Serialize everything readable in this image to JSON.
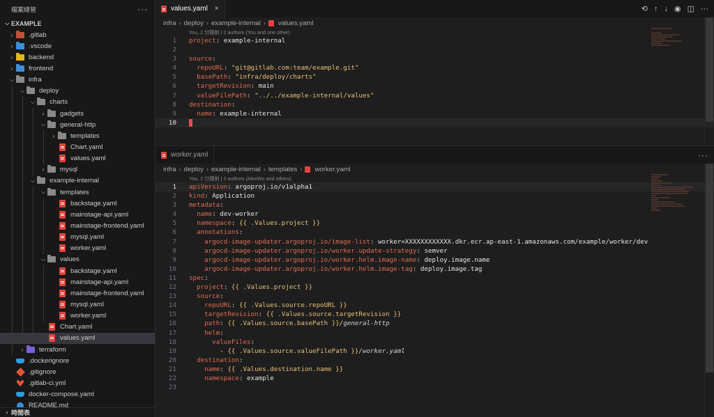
{
  "explorer": {
    "title": "檔案總管",
    "more_icon": "ellipsis-icon",
    "root": "EXAMPLE",
    "footer": "時間表",
    "items": [
      {
        "depth": 0,
        "label": ".gitlab",
        "kind": "folder",
        "open": false,
        "color": "#c0513a"
      },
      {
        "depth": 0,
        "label": ".vscode",
        "kind": "folder",
        "open": false,
        "color": "#3d8fd8"
      },
      {
        "depth": 0,
        "label": "backend",
        "kind": "folder",
        "open": false,
        "color": "#e6b422"
      },
      {
        "depth": 0,
        "label": "frontend",
        "kind": "folder",
        "open": false,
        "color": "#3d8fd8"
      },
      {
        "depth": 0,
        "label": "infra",
        "kind": "folder",
        "open": true,
        "color": "#8a8a8a"
      },
      {
        "depth": 1,
        "label": "deploy",
        "kind": "folder",
        "open": true,
        "color": "#8a8a8a"
      },
      {
        "depth": 2,
        "label": "charts",
        "kind": "folder",
        "open": true,
        "color": "#8a8a8a"
      },
      {
        "depth": 3,
        "label": "gadgets",
        "kind": "folder",
        "open": false,
        "color": "#8a8a8a"
      },
      {
        "depth": 3,
        "label": "general-http",
        "kind": "folder",
        "open": true,
        "color": "#8a8a8a"
      },
      {
        "depth": 4,
        "label": "templates",
        "kind": "folder",
        "open": false,
        "color": "#8a8a8a"
      },
      {
        "depth": 4,
        "label": "Chart.yaml",
        "kind": "file"
      },
      {
        "depth": 4,
        "label": "values.yaml",
        "kind": "file"
      },
      {
        "depth": 3,
        "label": "mysql",
        "kind": "folder",
        "open": false,
        "color": "#8a8a8a"
      },
      {
        "depth": 2,
        "label": "example-internal",
        "kind": "folder",
        "open": true,
        "color": "#8a8a8a"
      },
      {
        "depth": 3,
        "label": "templates",
        "kind": "folder",
        "open": true,
        "color": "#8a8a8a"
      },
      {
        "depth": 4,
        "label": "backstage.yaml",
        "kind": "file"
      },
      {
        "depth": 4,
        "label": "mainstage-api.yaml",
        "kind": "file"
      },
      {
        "depth": 4,
        "label": "mainstage-frontend.yaml",
        "kind": "file"
      },
      {
        "depth": 4,
        "label": "mysql.yaml",
        "kind": "file"
      },
      {
        "depth": 4,
        "label": "worker.yaml",
        "kind": "file"
      },
      {
        "depth": 3,
        "label": "values",
        "kind": "folder",
        "open": true,
        "color": "#8a8a8a"
      },
      {
        "depth": 4,
        "label": "backstage.yaml",
        "kind": "file"
      },
      {
        "depth": 4,
        "label": "mainstage-api.yaml",
        "kind": "file"
      },
      {
        "depth": 4,
        "label": "mainstage-frontend.yaml",
        "kind": "file"
      },
      {
        "depth": 4,
        "label": "mysql.yaml",
        "kind": "file"
      },
      {
        "depth": 4,
        "label": "worker.yaml",
        "kind": "file"
      },
      {
        "depth": 3,
        "label": "Chart.yaml",
        "kind": "file"
      },
      {
        "depth": 3,
        "label": "values.yaml",
        "kind": "file",
        "selected": true
      },
      {
        "depth": 1,
        "label": "terraform",
        "kind": "folder",
        "open": false,
        "color": "#7b61d8"
      },
      {
        "depth": 0,
        "label": ".dockerignore",
        "kind": "docker"
      },
      {
        "depth": 0,
        "label": ".gitignore",
        "kind": "git"
      },
      {
        "depth": 0,
        "label": ".gitlab-ci.yml",
        "kind": "fox"
      },
      {
        "depth": 0,
        "label": "docker-compose.yaml",
        "kind": "docker"
      },
      {
        "depth": 0,
        "label": "README.md",
        "kind": "info"
      }
    ]
  },
  "editor1": {
    "tab": "values.yaml",
    "close": "×",
    "breadcrumb": [
      "infra",
      "deploy",
      "example-internal",
      "values.yaml"
    ],
    "blame": "You, 2 分鐘前 | 2 authors (You and one other)",
    "active_line": 10,
    "lines": [
      [
        [
          "k",
          "project"
        ],
        [
          "p",
          ": "
        ],
        [
          "v",
          "example-internal"
        ]
      ],
      [],
      [
        [
          "k",
          "source"
        ],
        [
          "p",
          ":"
        ]
      ],
      [
        [
          "p",
          "  "
        ],
        [
          "k",
          "repoURL"
        ],
        [
          "p",
          ": "
        ],
        [
          "s",
          "\"git@gitlab.com:team/example.git\""
        ]
      ],
      [
        [
          "p",
          "  "
        ],
        [
          "k",
          "basePath"
        ],
        [
          "p",
          ": "
        ],
        [
          "s",
          "\"infra/deploy/charts\""
        ]
      ],
      [
        [
          "p",
          "  "
        ],
        [
          "k",
          "targetRevision"
        ],
        [
          "p",
          ": "
        ],
        [
          "v",
          "main"
        ]
      ],
      [
        [
          "p",
          "  "
        ],
        [
          "k",
          "valueFilePath"
        ],
        [
          "p",
          ": "
        ],
        [
          "s",
          "\"../../example-internal/values\""
        ]
      ],
      [
        [
          "k",
          "destination"
        ],
        [
          "p",
          ":"
        ]
      ],
      [
        [
          "p",
          "  "
        ],
        [
          "k",
          "name"
        ],
        [
          "p",
          ": "
        ],
        [
          "v",
          "example-internal"
        ]
      ],
      [
        [
          "cursor",
          ""
        ]
      ]
    ]
  },
  "editor2": {
    "tab": "worker.yaml",
    "breadcrumb": [
      "infra",
      "deploy",
      "example-internal",
      "templates",
      "worker.yaml"
    ],
    "blame": "You, 2 分鐘前 | 3 authors (AlexWu and others)",
    "active_line": 1,
    "lines": [
      [
        [
          "k",
          "apiVersion"
        ],
        [
          "p",
          ": "
        ],
        [
          "v",
          "argoproj.io/v1alpha1"
        ]
      ],
      [
        [
          "k",
          "kind"
        ],
        [
          "p",
          ": "
        ],
        [
          "v",
          "Application"
        ]
      ],
      [
        [
          "k",
          "metadata"
        ],
        [
          "p",
          ":"
        ]
      ],
      [
        [
          "p",
          "  "
        ],
        [
          "k",
          "name"
        ],
        [
          "p",
          ": "
        ],
        [
          "v",
          "dev-worker"
        ]
      ],
      [
        [
          "p",
          "  "
        ],
        [
          "k",
          "namespace"
        ],
        [
          "p",
          ": "
        ],
        [
          "b",
          "{{ .Values.project }}"
        ]
      ],
      [
        [
          "p",
          "  "
        ],
        [
          "k",
          "annotations"
        ],
        [
          "p",
          ":"
        ]
      ],
      [
        [
          "p",
          "    "
        ],
        [
          "k",
          "argocd-image-updater.argoproj.io/image-list"
        ],
        [
          "p",
          ": "
        ],
        [
          "v",
          "worker=XXXXXXXXXXXX.dkr.ecr.ap-east-1.amazonaws.com/example/worker/dev"
        ]
      ],
      [
        [
          "p",
          "    "
        ],
        [
          "k",
          "argocd-image-updater.argoproj.io/worker.update-strategy"
        ],
        [
          "p",
          ": "
        ],
        [
          "v",
          "semver"
        ]
      ],
      [
        [
          "p",
          "    "
        ],
        [
          "k",
          "argocd-image-updater.argoproj.io/worker.helm.image-name"
        ],
        [
          "p",
          ": "
        ],
        [
          "v",
          "deploy.image.name"
        ]
      ],
      [
        [
          "p",
          "    "
        ],
        [
          "k",
          "argocd-image-updater.argoproj.io/worker.helm.image-tag"
        ],
        [
          "p",
          ": "
        ],
        [
          "v",
          "deploy.image.tag"
        ]
      ],
      [
        [
          "k",
          "spec"
        ],
        [
          "p",
          ":"
        ]
      ],
      [
        [
          "p",
          "  "
        ],
        [
          "k",
          "project"
        ],
        [
          "p",
          ": "
        ],
        [
          "b",
          "{{ .Values.project }}"
        ]
      ],
      [
        [
          "p",
          "  "
        ],
        [
          "k",
          "source"
        ],
        [
          "p",
          ":"
        ]
      ],
      [
        [
          "p",
          "    "
        ],
        [
          "k",
          "repoURL"
        ],
        [
          "p",
          ": "
        ],
        [
          "b",
          "{{ .Values.source.repoURL }}"
        ]
      ],
      [
        [
          "p",
          "    "
        ],
        [
          "k",
          "targetRevision"
        ],
        [
          "p",
          ": "
        ],
        [
          "b",
          "{{ .Values.source.targetRevision }}"
        ]
      ],
      [
        [
          "p",
          "    "
        ],
        [
          "k",
          "path"
        ],
        [
          "p",
          ": "
        ],
        [
          "b",
          "{{ .Values.source.basePath }}"
        ],
        [
          "it",
          "/general-http"
        ]
      ],
      [
        [
          "p",
          "    "
        ],
        [
          "k",
          "helm"
        ],
        [
          "p",
          ":"
        ]
      ],
      [
        [
          "p",
          "      "
        ],
        [
          "k",
          "valueFiles"
        ],
        [
          "p",
          ":"
        ]
      ],
      [
        [
          "p",
          "        - "
        ],
        [
          "b",
          "{{ .Values.source.valueFilePath }}"
        ],
        [
          "it",
          "/worker.yaml"
        ]
      ],
      [
        [
          "p",
          "  "
        ],
        [
          "k",
          "destination"
        ],
        [
          "p",
          ":"
        ]
      ],
      [
        [
          "p",
          "    "
        ],
        [
          "k",
          "name"
        ],
        [
          "p",
          ": "
        ],
        [
          "b",
          "{{ .Values.destination.name }}"
        ]
      ],
      [
        [
          "p",
          "    "
        ],
        [
          "k",
          "namespace"
        ],
        [
          "p",
          ": "
        ],
        [
          "v",
          "example"
        ]
      ],
      []
    ]
  },
  "icons": {
    "tab_actions": [
      "open-changes-icon",
      "previous-change-icon",
      "next-change-icon",
      "git-graph-icon",
      "split-editor-icon",
      "ellipsis-icon"
    ]
  }
}
